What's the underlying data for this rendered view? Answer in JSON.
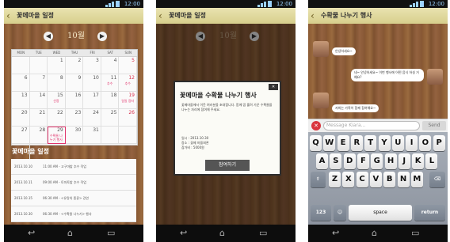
{
  "status": {
    "time": "12:00"
  },
  "phone1": {
    "title": "꽃메마을 일정",
    "month": "10월",
    "weekdays": [
      "MON",
      "TUE",
      "WED",
      "THU",
      "FRI",
      "SAT",
      "SUN"
    ],
    "days": [
      "",
      "",
      "1",
      "2",
      "3",
      "4",
      "5",
      "6",
      "7",
      "8",
      "9",
      "10",
      "11",
      "12",
      "13",
      "14",
      "15",
      "16",
      "17",
      "18",
      "19",
      "20",
      "21",
      "22",
      "23",
      "24",
      "25",
      "26",
      "27",
      "28",
      "29",
      "30",
      "31",
      "",
      "",
      ""
    ],
    "events": {
      "11": "추수",
      "12": "추수",
      "15": "선정",
      "19": "일일 장터",
      "29": "수확물 나누기 행사"
    },
    "section": "꽃메마을 일정",
    "list": [
      {
        "date": "2013.10.10",
        "text": "11:00 AM - 고구마밭 추수 작업"
      },
      {
        "date": "2013.10.11",
        "text": "09:00 AM - 토마토밭 추수 작업"
      },
      {
        "date": "2013.10.15",
        "text": "06:30 AM - <유랑의 종류> 강연"
      },
      {
        "date": "2013.10.30",
        "text": "06:30 AM - <수확물 나누기> 행사"
      }
    ]
  },
  "phone2": {
    "month": "10월",
    "dialog": {
      "title": "꽃메마을 수확물 나누기 행사",
      "body": "꽃메마을에서 이웃 여러분을 초대합니다. 함께 땀 흘려 가꾼 수확물을 나누는 자리에 참여해 주세요.",
      "info": [
        "일시 : 2013.10.30",
        "장소 : 꽃메 마을회관",
        "참가비 : 5000원"
      ],
      "button": "참여하기"
    }
  },
  "phone3": {
    "title": "수확물 나누기 행사",
    "messages": [
      "안녕하세요~",
      "네~ 안녕하세요~ 이번 행사에 어떤 음식 하실 거예요?",
      "저희는 가족이 함께 참여해요~"
    ],
    "input_placeholder": "Message Kiara...",
    "send": "Send",
    "keyboard": [
      [
        "Q",
        "W",
        "E",
        "R",
        "T",
        "Y",
        "U",
        "I",
        "O",
        "P"
      ],
      [
        "A",
        "S",
        "D",
        "F",
        "G",
        "H",
        "J",
        "K",
        "L"
      ],
      [
        "Z",
        "X",
        "C",
        "V",
        "B",
        "N",
        "M"
      ]
    ],
    "kb_bottom": {
      "num": "123",
      "space": "space",
      "return": "return"
    }
  }
}
